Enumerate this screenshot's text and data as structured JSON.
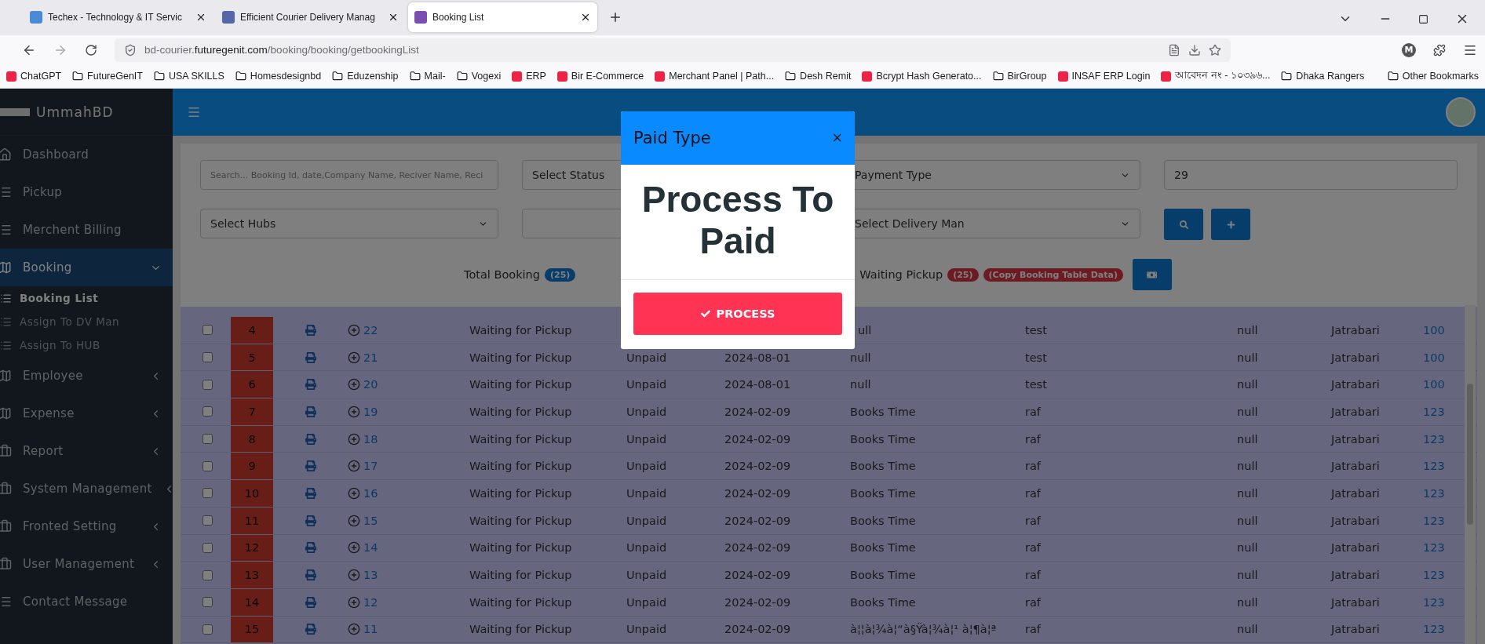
{
  "browser": {
    "tabs": [
      {
        "title": "Techex - Technology & IT Servic",
        "selected": false
      },
      {
        "title": "Efficient Courier Delivery Manag",
        "selected": false
      },
      {
        "title": "Booking List",
        "selected": true
      }
    ],
    "url": {
      "host_prefix": "bd-courier.",
      "host": "futuregenit.com",
      "path": "/booking/booking/getbookingList"
    },
    "profile_initial": "M",
    "bookmarks": [
      {
        "label": "ChatGPT",
        "kind": "site"
      },
      {
        "label": "FutureGenIT",
        "kind": "folder"
      },
      {
        "label": "USA SKILLS",
        "kind": "folder"
      },
      {
        "label": "Homesdesignbd",
        "kind": "folder"
      },
      {
        "label": "Eduzenship",
        "kind": "folder"
      },
      {
        "label": "Mail-",
        "kind": "folder"
      },
      {
        "label": "Vogexi",
        "kind": "folder"
      },
      {
        "label": "ERP",
        "kind": "site"
      },
      {
        "label": "Bir E-Commerce",
        "kind": "site"
      },
      {
        "label": "Merchant Panel | Path...",
        "kind": "site"
      },
      {
        "label": "Desh Remit",
        "kind": "folder"
      },
      {
        "label": "Bcrypt Hash Generato...",
        "kind": "site"
      },
      {
        "label": "BirGroup",
        "kind": "folder"
      },
      {
        "label": "INSAF ERP Login",
        "kind": "site"
      },
      {
        "label": "আবেদন নং - ১০৩৯৬...",
        "kind": "site"
      },
      {
        "label": "Dhaka Rangers",
        "kind": "folder"
      }
    ],
    "other_bookmarks": "Other Bookmarks"
  },
  "sidebar": {
    "brand": "UmmahBD",
    "items": [
      {
        "label": "Dashboard",
        "kind": "link",
        "selected": false
      },
      {
        "label": "Pickup",
        "kind": "link",
        "selected": false
      },
      {
        "label": "Merchent Billing",
        "kind": "link",
        "selected": false
      },
      {
        "label": "Booking",
        "kind": "group",
        "expanded": true,
        "selected": true,
        "children": [
          {
            "label": "Booking List",
            "selected": true
          },
          {
            "label": "Assign To DV Man",
            "selected": false
          },
          {
            "label": "Assign To HUB",
            "selected": false
          }
        ]
      },
      {
        "label": "Employee",
        "kind": "group",
        "expanded": false,
        "selected": false
      },
      {
        "label": "Expense",
        "kind": "group",
        "expanded": false,
        "selected": false
      },
      {
        "label": "Report",
        "kind": "group",
        "expanded": false,
        "selected": false
      },
      {
        "label": "System Management",
        "kind": "group",
        "expanded": false,
        "selected": false
      },
      {
        "label": "Fronted Setting",
        "kind": "group",
        "expanded": false,
        "selected": false
      },
      {
        "label": "User Management",
        "kind": "group",
        "expanded": false,
        "selected": false
      },
      {
        "label": "Contact Message",
        "kind": "link",
        "selected": false
      }
    ]
  },
  "filters": {
    "search": {
      "placeholder": "Search... Booking Id, date,Company Name, Reciver Name, Reci"
    },
    "status": "Select Status",
    "payment": "Payment Type",
    "count_value": "29",
    "hubs": "Select Hubs",
    "delivery_man": "Select Delivery Man"
  },
  "stats": {
    "total_label": "Total Booking",
    "total_count": "(25)",
    "waiting_label": "Waiting Pickup",
    "waiting_count": "(25)",
    "copy_badge": "(Copy Booking Table Data)"
  },
  "table": {
    "rows": [
      {
        "sl": "4",
        "id": "22",
        "status": "Waiting for Pickup",
        "company": "ull",
        "receiver": "test",
        "column_10": "null",
        "hub": "Jatrabari",
        "amount": "100",
        "checked": false
      },
      {
        "sl": "5",
        "id": "21",
        "status": "Waiting for Pickup",
        "payment": "Unpaid",
        "date": "2024-08-01",
        "company": "null",
        "receiver": "test",
        "column_10": "null",
        "hub": "Jatrabari",
        "amount": "100",
        "checked": false
      },
      {
        "sl": "6",
        "id": "20",
        "status": "Waiting for Pickup",
        "payment": "Unpaid",
        "date": "2024-08-01",
        "company": "null",
        "receiver": "test",
        "column_10": "null",
        "hub": "Jatrabari",
        "amount": "100",
        "checked": false
      },
      {
        "sl": "7",
        "id": "19",
        "status": "Waiting for Pickup",
        "payment": "Unpaid",
        "date": "2024-02-09",
        "company": "Books Time",
        "receiver": "raf",
        "column_10": "null",
        "hub": "Jatrabari",
        "amount": "123",
        "checked": false
      },
      {
        "sl": "8",
        "id": "18",
        "status": "Waiting for Pickup",
        "payment": "Unpaid",
        "date": "2024-02-09",
        "company": "Books Time",
        "receiver": "raf",
        "column_10": "null",
        "hub": "Jatrabari",
        "amount": "123",
        "checked": false
      },
      {
        "sl": "9",
        "id": "17",
        "status": "Waiting for Pickup",
        "payment": "Unpaid",
        "date": "2024-02-09",
        "company": "Books Time",
        "receiver": "raf",
        "column_10": "null",
        "hub": "Jatrabari",
        "amount": "123",
        "checked": false
      },
      {
        "sl": "10",
        "id": "16",
        "status": "Waiting for Pickup",
        "payment": "Unpaid",
        "date": "2024-02-09",
        "company": "Books Time",
        "receiver": "raf",
        "column_10": "null",
        "hub": "Jatrabari",
        "amount": "123",
        "checked": false
      },
      {
        "sl": "11",
        "id": "15",
        "status": "Waiting for Pickup",
        "payment": "Unpaid",
        "date": "2024-02-09",
        "company": "Books Time",
        "receiver": "raf",
        "column_10": "null",
        "hub": "Jatrabari",
        "amount": "123",
        "checked": false
      },
      {
        "sl": "12",
        "id": "14",
        "status": "Waiting for Pickup",
        "payment": "Unpaid",
        "date": "2024-02-09",
        "company": "Books Time",
        "receiver": "raf",
        "column_10": "null",
        "hub": "Jatrabari",
        "amount": "123",
        "checked": false
      },
      {
        "sl": "13",
        "id": "13",
        "status": "Waiting for Pickup",
        "payment": "Unpaid",
        "date": "2024-02-09",
        "company": "Books Time",
        "receiver": "raf",
        "column_10": "null",
        "hub": "Jatrabari",
        "amount": "123",
        "checked": false
      },
      {
        "sl": "14",
        "id": "12",
        "status": "Waiting for Pickup",
        "payment": "Unpaid",
        "date": "2024-02-09",
        "company": "Books Time",
        "receiver": "raf",
        "column_10": "null",
        "hub": "Jatrabari",
        "amount": "123",
        "checked": false
      },
      {
        "sl": "15",
        "id": "11",
        "status": "Waiting for Pickup",
        "payment": "Unpaid",
        "date": "2024-02-09",
        "company": "à¦¦à¦¾à¦“à§Ÿà¦¾à¦¹ à¦¶à¦ª",
        "receiver": "raf",
        "column_10": "null",
        "hub": "Jatrabari",
        "amount": "123",
        "checked": false
      }
    ]
  },
  "modal": {
    "title": "Paid Type",
    "close": "×",
    "heading": "Process To Paid",
    "button": "PROCESS"
  }
}
